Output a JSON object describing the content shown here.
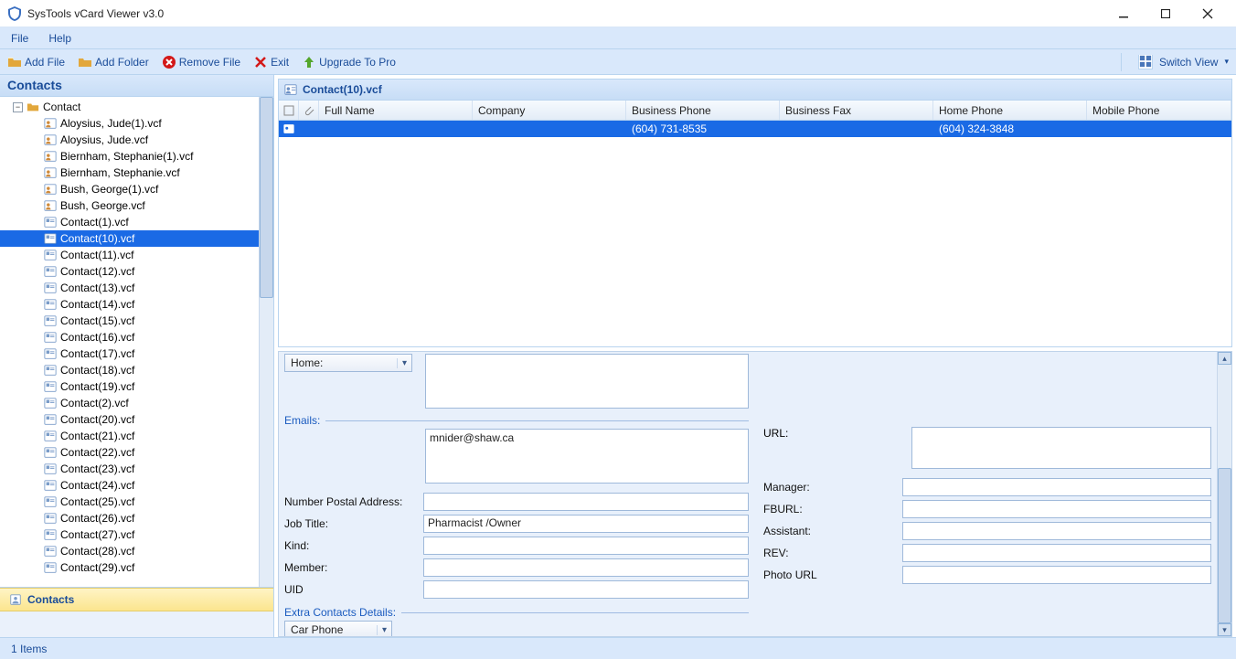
{
  "app": {
    "title": "SysTools vCard Viewer v3.0"
  },
  "menu": {
    "file": "File",
    "help": "Help"
  },
  "toolbar": {
    "add_file": "Add File",
    "add_folder": "Add Folder",
    "remove_file": "Remove File",
    "exit": "Exit",
    "upgrade": "Upgrade To Pro",
    "switch_view": "Switch View"
  },
  "sidebar": {
    "title": "Contacts",
    "root": "Contact",
    "files": [
      "Aloysius, Jude(1).vcf",
      "Aloysius, Jude.vcf",
      "Biernham, Stephanie(1).vcf",
      "Biernham, Stephanie.vcf",
      "Bush, George(1).vcf",
      "Bush, George.vcf",
      "Contact(1).vcf",
      "Contact(10).vcf",
      "Contact(11).vcf",
      "Contact(12).vcf",
      "Contact(13).vcf",
      "Contact(14).vcf",
      "Contact(15).vcf",
      "Contact(16).vcf",
      "Contact(17).vcf",
      "Contact(18).vcf",
      "Contact(19).vcf",
      "Contact(2).vcf",
      "Contact(20).vcf",
      "Contact(21).vcf",
      "Contact(22).vcf",
      "Contact(23).vcf",
      "Contact(24).vcf",
      "Contact(25).vcf",
      "Contact(26).vcf",
      "Contact(27).vcf",
      "Contact(28).vcf",
      "Contact(29).vcf"
    ],
    "selected_index": 7,
    "bottom_label": "Contacts"
  },
  "content": {
    "title": "Contact(10).vcf",
    "columns": [
      "Full Name",
      "Company",
      "Business Phone",
      "Business Fax",
      "Home Phone",
      "Mobile Phone"
    ],
    "row": {
      "full_name": "",
      "company": "",
      "business_phone": "(604) 731-8535",
      "business_fax": "",
      "home_phone": "(604) 324-3848",
      "mobile_phone": ""
    }
  },
  "details": {
    "addr_type": "Home:",
    "emails_label": "Emails:",
    "email_value": "mnider@shaw.ca",
    "url_label": "URL:",
    "npa_label": "Number Postal Address:",
    "job_label": "Job Title:",
    "job_value": "Pharmacist /Owner",
    "kind_label": "Kind:",
    "member_label": "Member:",
    "uid_label": "UID",
    "manager_label": "Manager:",
    "fburl_label": "FBURL:",
    "assistant_label": "Assistant:",
    "rev_label": "REV:",
    "photo_label": "Photo URL",
    "extra_label": "Extra Contacts Details:",
    "extra_type": "Car Phone"
  },
  "status": {
    "items": "1 Items"
  }
}
